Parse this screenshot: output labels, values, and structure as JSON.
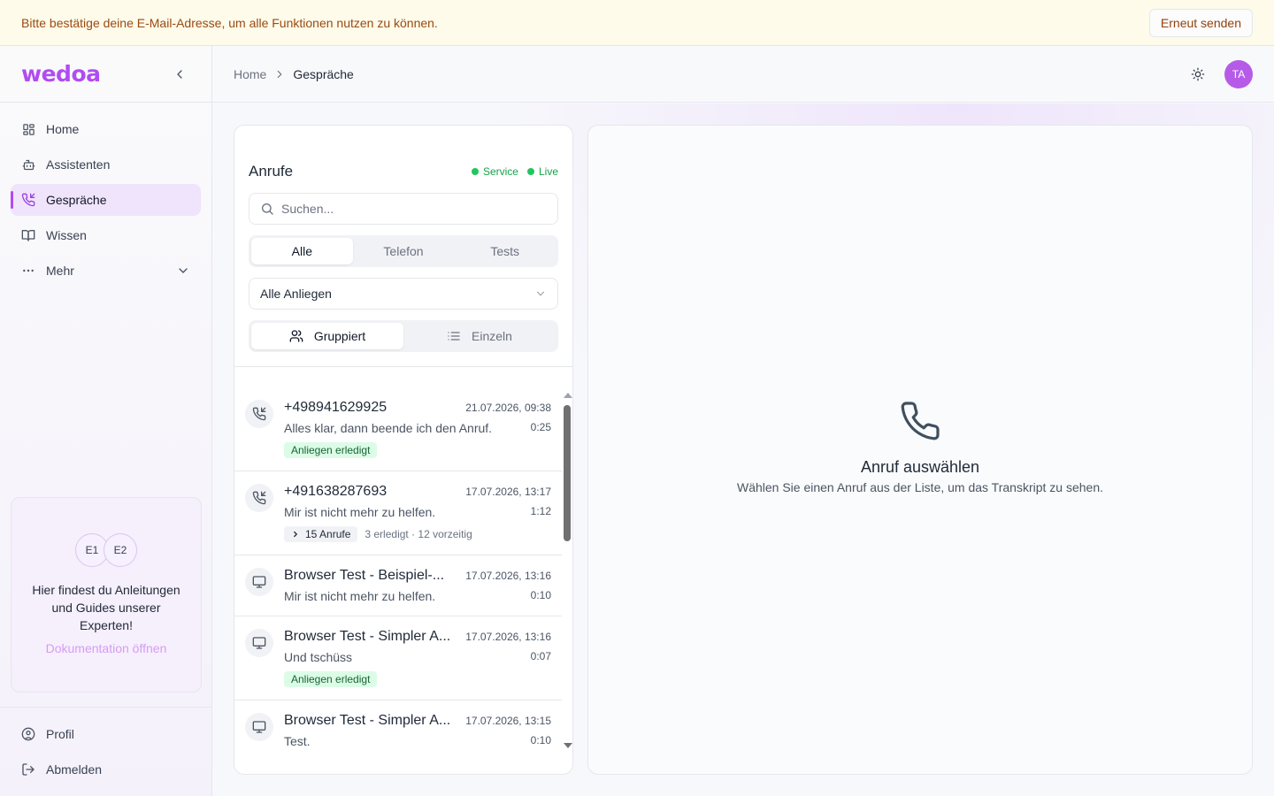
{
  "banner": {
    "text": "Bitte bestätige deine E-Mail-Adresse, um alle Funktionen nutzen zu können.",
    "button": "Erneut senden"
  },
  "sidebar": {
    "logo": "wedoa",
    "items": [
      {
        "label": "Home",
        "icon": "grid-icon"
      },
      {
        "label": "Assistenten",
        "icon": "bot-icon"
      },
      {
        "label": "Gespräche",
        "icon": "phone-incoming-icon",
        "active": true
      },
      {
        "label": "Wissen",
        "icon": "book-icon"
      },
      {
        "label": "Mehr",
        "icon": "more-icon"
      }
    ],
    "doc_card": {
      "avatars": [
        "E1",
        "E2"
      ],
      "text": "Hier findest du Anleitungen und Guides unserer Experten!",
      "link": "Dokumentation öffnen"
    },
    "bottom": [
      {
        "label": "Profil",
        "icon": "user-circle-icon"
      },
      {
        "label": "Abmelden",
        "icon": "logout-icon"
      }
    ]
  },
  "header": {
    "breadcrumb": [
      "Home",
      "Gespräche"
    ],
    "avatar": "TA"
  },
  "calls": {
    "title": "Anrufe",
    "status": [
      "Service",
      "Live"
    ],
    "search_placeholder": "Suchen...",
    "tabs": [
      "Alle",
      "Telefon",
      "Tests"
    ],
    "active_tab": "Alle",
    "filter": "Alle Anliegen",
    "view_modes": [
      "Gruppiert",
      "Einzeln"
    ],
    "active_view": "Gruppiert",
    "items": [
      {
        "name": "+498941629925",
        "date": "21.07.2026, 09:38",
        "message": "Alles klar, dann beende ich den Anruf.",
        "duration": "0:25",
        "badge": "Anliegen erledigt",
        "icon": "phone-incoming-icon"
      },
      {
        "name": "+491638287693",
        "date": "17.07.2026, 13:17",
        "message": "Mir ist nicht mehr zu helfen.",
        "duration": "1:12",
        "group_chip": "15 Anrufe",
        "group_meta": "3 erledigt · 12 vorzeitig",
        "icon": "phone-incoming-icon"
      },
      {
        "name": "Browser Test - Beispiel-...",
        "date": "17.07.2026, 13:16",
        "message": "Mir ist nicht mehr zu helfen.",
        "duration": "0:10",
        "icon": "monitor-icon"
      },
      {
        "name": "Browser Test - Simpler A...",
        "date": "17.07.2026, 13:16",
        "message": "Und tschüss",
        "duration": "0:07",
        "badge": "Anliegen erledigt",
        "icon": "monitor-icon"
      },
      {
        "name": "Browser Test - Simpler A...",
        "date": "17.07.2026, 13:15",
        "message": "Test.",
        "duration": "0:10",
        "icon": "monitor-icon"
      }
    ]
  },
  "detail": {
    "empty_title": "Anruf auswählen",
    "empty_text": "Wählen Sie einen Anruf aus der Liste, um das Transkript zu sehen."
  },
  "colors": {
    "accent": "#b04cf2",
    "banner_bg": "#fefbea",
    "success": "#22c55e"
  }
}
